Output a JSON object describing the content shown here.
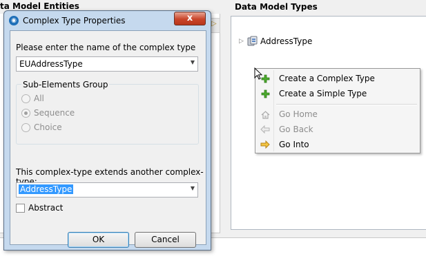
{
  "background": {
    "left_panel_title": "ta Model Entities",
    "right_panel_title": "Data Model Types",
    "tree": [
      {
        "label": "AddressType",
        "icon": "complex-type-icon"
      }
    ]
  },
  "context_menu": {
    "items": [
      {
        "label": "Create a Complex Type",
        "icon": "green-plus-icon",
        "enabled": true
      },
      {
        "label": "Create a Simple Type",
        "icon": "green-plus-icon",
        "enabled": true
      },
      {
        "label": "Go Home",
        "icon": "home-icon",
        "enabled": false
      },
      {
        "label": "Go Back",
        "icon": "back-arrow-icon",
        "enabled": false
      },
      {
        "label": "Go Into",
        "icon": "forward-arrow-icon",
        "enabled": true
      }
    ]
  },
  "dialog": {
    "title": "Complex Type Properties",
    "close_label": "x",
    "name_prompt": "Please enter the name of the complex type",
    "name_value": "EUAddressType",
    "group_title": "Sub-Elements Group",
    "radio_options": [
      {
        "label": "All",
        "checked": false
      },
      {
        "label": "Sequence",
        "checked": true
      },
      {
        "label": "Choice",
        "checked": false
      }
    ],
    "extends_prompt": "This complex-type extends another complex-type:",
    "extends_value": "AddressType",
    "abstract_label": "Abstract",
    "abstract_checked": false,
    "ok_label": "OK",
    "cancel_label": "Cancel"
  },
  "colors": {
    "dialog_frame": "#c5d9ee",
    "close_button": "#c9452a",
    "selection": "#3399ff",
    "menu_background": "#f5f5f5"
  }
}
